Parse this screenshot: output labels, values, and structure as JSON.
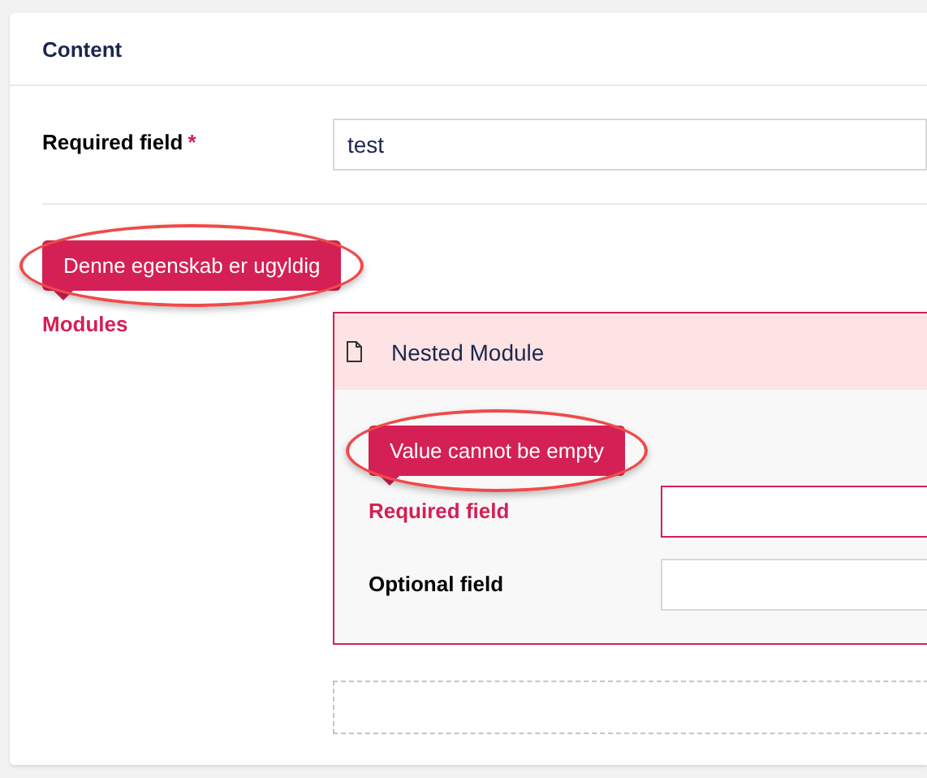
{
  "section": {
    "title": "Content"
  },
  "fields": [
    {
      "label": "Required field",
      "required_mark": "*",
      "value": "test",
      "invalid": false
    }
  ],
  "modules_property": {
    "label": "Modules",
    "invalid": true,
    "error": {
      "text": "Denne egenskab er ugyldig",
      "highlighted": true
    },
    "modules": [
      {
        "title": "Nested Module",
        "invalid": true,
        "error": {
          "text": "Value cannot be empty",
          "highlighted": true
        },
        "fields": [
          {
            "label": "Required field",
            "invalid": true
          },
          {
            "label": "Optional field",
            "invalid": false
          }
        ]
      }
    ]
  }
}
